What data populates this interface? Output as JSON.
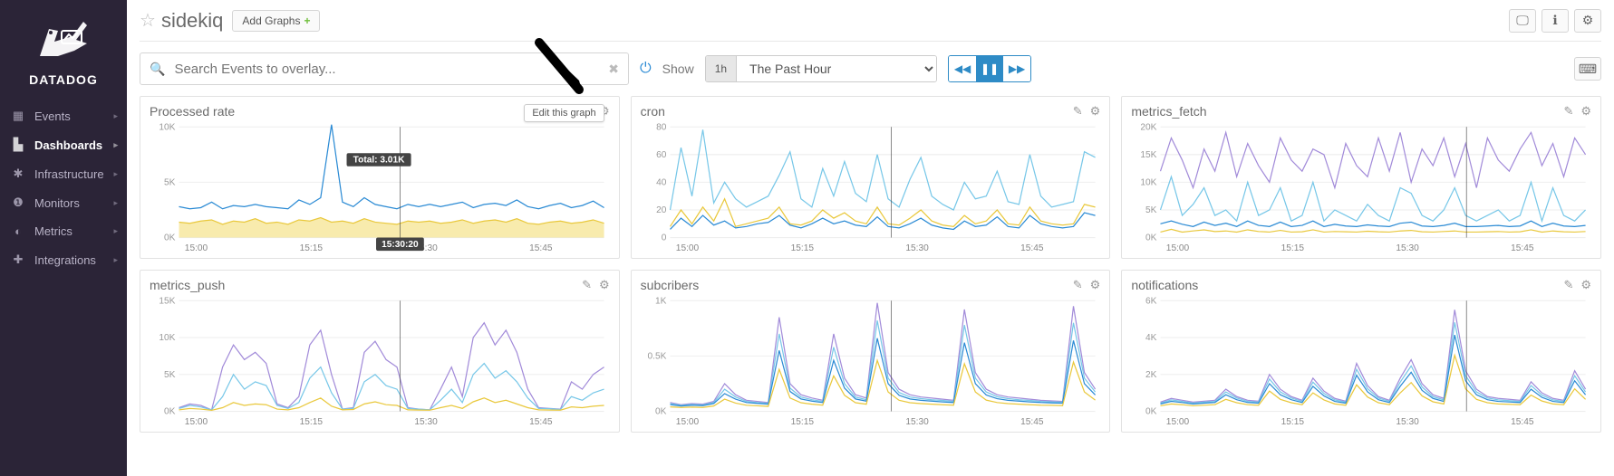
{
  "brand": "DATADOG",
  "nav": {
    "items": [
      {
        "icon": "calendar-icon",
        "label": "Events"
      },
      {
        "icon": "chart-icon",
        "label": "Dashboards",
        "active": true
      },
      {
        "icon": "nodes-icon",
        "label": "Infrastructure"
      },
      {
        "icon": "alert-icon",
        "label": "Monitors"
      },
      {
        "icon": "gauge-icon",
        "label": "Metrics"
      },
      {
        "icon": "plug-icon",
        "label": "Integrations"
      }
    ]
  },
  "header": {
    "title": "sidekiq",
    "add_graphs_label": "Add Graphs"
  },
  "toolbar": {
    "search_placeholder": "Search Events to overlay...",
    "show_label": "Show",
    "range_pill": "1h",
    "range_select": "The Past Hour"
  },
  "tooltip": {
    "edit_graph": "Edit this graph"
  },
  "cursor": {
    "time_label": "15:30:20",
    "total_label": "Total: 3.01K"
  },
  "x_ticks": [
    "15:00",
    "15:15",
    "15:30",
    "15:45"
  ],
  "colors": {
    "blue": "#2a8ad4",
    "cyan": "#77c7e8",
    "purple": "#a28bd9",
    "gold": "#e9c83c"
  },
  "chart_data": [
    {
      "id": "processed_rate",
      "title": "Processed rate",
      "type": "line",
      "x_ticks": [
        "15:00",
        "15:15",
        "15:30",
        "15:45"
      ],
      "ylim": [
        0,
        10000
      ],
      "y_ticks": [
        0,
        5000,
        10000
      ],
      "y_tick_labels": [
        "0K",
        "5K",
        "10K"
      ],
      "cursor_x": 0.52,
      "series": [
        {
          "name": "blue",
          "color": "#2a8ad4",
          "values": [
            2800,
            2600,
            2700,
            3200,
            2600,
            2900,
            2800,
            3000,
            2800,
            2700,
            2600,
            3400,
            3000,
            3600,
            10200,
            3200,
            2800,
            3600,
            3000,
            2800,
            2600,
            3000,
            2800,
            3011,
            2800,
            3000,
            3200,
            2700,
            3000,
            3100,
            2900,
            3400,
            2800,
            2600,
            2900,
            3100,
            2700,
            2900,
            3300,
            2700
          ]
        },
        {
          "name": "gold_area",
          "color": "#e9c83c",
          "area": true,
          "values": [
            1400,
            1300,
            1500,
            1600,
            1200,
            1500,
            1400,
            1700,
            1300,
            1400,
            1200,
            1600,
            1500,
            1800,
            1400,
            1500,
            1300,
            1700,
            1400,
            1300,
            1200,
            1500,
            1400,
            1500,
            1300,
            1400,
            1600,
            1300,
            1500,
            1600,
            1400,
            1700,
            1300,
            1200,
            1400,
            1500,
            1300,
            1400,
            1600,
            1300
          ]
        }
      ]
    },
    {
      "id": "cron",
      "title": "cron",
      "type": "line",
      "x_ticks": [
        "15:00",
        "15:15",
        "15:30",
        "15:45"
      ],
      "ylim": [
        0,
        80
      ],
      "y_ticks": [
        0,
        20,
        40,
        60,
        80
      ],
      "y_tick_labels": [
        "0",
        "20",
        "40",
        "60",
        "80"
      ],
      "cursor_x": 0.52,
      "series": [
        {
          "name": "cyan",
          "color": "#77c7e8",
          "values": [
            20,
            65,
            30,
            78,
            25,
            40,
            28,
            22,
            26,
            30,
            45,
            62,
            28,
            22,
            50,
            30,
            55,
            32,
            26,
            60,
            28,
            22,
            42,
            58,
            30,
            24,
            20,
            40,
            28,
            30,
            48,
            26,
            24,
            60,
            30,
            22,
            24,
            26,
            62,
            58
          ]
        },
        {
          "name": "gold",
          "color": "#e9c83c",
          "values": [
            8,
            20,
            10,
            22,
            12,
            28,
            8,
            10,
            12,
            14,
            22,
            10,
            9,
            12,
            20,
            14,
            18,
            12,
            10,
            22,
            10,
            9,
            14,
            20,
            12,
            9,
            8,
            16,
            10,
            12,
            20,
            10,
            9,
            22,
            12,
            10,
            9,
            10,
            24,
            22
          ]
        },
        {
          "name": "blue",
          "color": "#2a8ad4",
          "values": [
            6,
            14,
            8,
            16,
            9,
            12,
            7,
            8,
            10,
            11,
            16,
            9,
            7,
            10,
            14,
            10,
            12,
            9,
            8,
            15,
            8,
            7,
            10,
            14,
            9,
            7,
            6,
            12,
            8,
            9,
            15,
            8,
            7,
            16,
            10,
            8,
            7,
            8,
            18,
            16
          ]
        }
      ]
    },
    {
      "id": "metrics_fetch",
      "title": "metrics_fetch",
      "type": "line",
      "x_ticks": [
        "15:00",
        "15:15",
        "15:30",
        "15:45"
      ],
      "ylim": [
        0,
        20000
      ],
      "y_ticks": [
        0,
        5000,
        10000,
        15000,
        20000
      ],
      "y_tick_labels": [
        "0K",
        "5K",
        "10K",
        "15K",
        "20K"
      ],
      "cursor_x": 0.72,
      "series": [
        {
          "name": "purple",
          "color": "#a28bd9",
          "values": [
            12000,
            18000,
            14000,
            9000,
            16000,
            12000,
            19000,
            11000,
            17000,
            13000,
            10000,
            18000,
            14000,
            12000,
            16000,
            15000,
            9000,
            17000,
            13000,
            11000,
            18000,
            12000,
            19000,
            10000,
            16000,
            13000,
            18000,
            11000,
            17000,
            9000,
            18000,
            14000,
            12000,
            16000,
            19000,
            13000,
            17000,
            11000,
            18000,
            15000
          ]
        },
        {
          "name": "cyan",
          "color": "#77c7e8",
          "values": [
            5000,
            11000,
            4000,
            6000,
            9000,
            4000,
            5000,
            3000,
            10000,
            4000,
            5000,
            9000,
            3000,
            4000,
            10000,
            3000,
            5000,
            4000,
            3000,
            6000,
            4000,
            3000,
            9000,
            8000,
            4000,
            3000,
            5000,
            9000,
            4000,
            3000,
            4000,
            5000,
            3000,
            4000,
            10000,
            3000,
            9000,
            4000,
            3000,
            5000
          ]
        },
        {
          "name": "blue",
          "color": "#2a8ad4",
          "values": [
            2500,
            3000,
            2400,
            2000,
            2800,
            2200,
            2600,
            2000,
            3000,
            2200,
            2000,
            2800,
            2000,
            2200,
            3000,
            2000,
            2400,
            2100,
            2000,
            2300,
            2100,
            2000,
            2600,
            2800,
            2100,
            2000,
            2200,
            2600,
            2000,
            2000,
            2100,
            2200,
            2000,
            2100,
            3000,
            2000,
            2600,
            2100,
            2000,
            2200
          ]
        },
        {
          "name": "gold",
          "color": "#e9c83c",
          "values": [
            1000,
            1500,
            1000,
            1200,
            1400,
            1100,
            1200,
            1000,
            1400,
            1100,
            1000,
            1300,
            1000,
            1050,
            1400,
            1000,
            1100,
            1050,
            1000,
            1150,
            1050,
            1000,
            1200,
            1300,
            1050,
            1000,
            1100,
            1200,
            1000,
            1000,
            1050,
            1100,
            1000,
            1050,
            1400,
            1000,
            1200,
            1050,
            1000,
            1100
          ]
        }
      ]
    },
    {
      "id": "metrics_push",
      "title": "metrics_push",
      "type": "line",
      "x_ticks": [
        "15:00",
        "15:15",
        "15:30",
        "15:45"
      ],
      "ylim": [
        0,
        15000
      ],
      "y_ticks": [
        0,
        5000,
        10000,
        15000
      ],
      "y_tick_labels": [
        "0K",
        "5K",
        "10K",
        "15K"
      ],
      "cursor_x": 0.52,
      "series": [
        {
          "name": "purple",
          "color": "#a28bd9",
          "values": [
            500,
            1000,
            800,
            200,
            6000,
            9000,
            7000,
            8000,
            6500,
            1000,
            500,
            2000,
            9000,
            11000,
            5000,
            300,
            500,
            8000,
            9500,
            7000,
            6000,
            500,
            300,
            200,
            3000,
            6000,
            2000,
            10000,
            12000,
            9000,
            11000,
            8000,
            3000,
            500,
            400,
            300,
            4000,
            3000,
            5000,
            6000
          ]
        },
        {
          "name": "cyan",
          "color": "#77c7e8",
          "values": [
            400,
            800,
            600,
            200,
            2000,
            5000,
            3000,
            4000,
            3500,
            800,
            400,
            1200,
            4500,
            6000,
            2500,
            300,
            400,
            4000,
            5000,
            3500,
            3000,
            400,
            300,
            200,
            1500,
            3000,
            1200,
            5000,
            6500,
            4500,
            5500,
            4000,
            1800,
            400,
            350,
            250,
            2000,
            1500,
            2500,
            3000
          ]
        },
        {
          "name": "gold",
          "color": "#e9c83c",
          "values": [
            200,
            400,
            300,
            150,
            500,
            1200,
            800,
            1000,
            900,
            300,
            200,
            500,
            1200,
            1800,
            700,
            200,
            250,
            1000,
            1300,
            900,
            800,
            200,
            180,
            150,
            500,
            800,
            400,
            1300,
            1800,
            1200,
            1500,
            1000,
            500,
            200,
            180,
            160,
            600,
            500,
            700,
            800
          ]
        }
      ]
    },
    {
      "id": "subcribers",
      "title": "subcribers",
      "type": "line",
      "x_ticks": [
        "15:00",
        "15:15",
        "15:30",
        "15:45"
      ],
      "ylim": [
        0,
        1000
      ],
      "y_ticks": [
        0,
        500,
        1000
      ],
      "y_tick_labels": [
        "0K",
        "0.5K",
        "1K"
      ],
      "cursor_x": 0.52,
      "series": [
        {
          "name": "purple",
          "color": "#a28bd9",
          "values": [
            80,
            60,
            70,
            65,
            90,
            250,
            150,
            100,
            90,
            80,
            850,
            250,
            150,
            120,
            100,
            700,
            300,
            150,
            120,
            980,
            350,
            200,
            150,
            130,
            120,
            110,
            100,
            920,
            350,
            200,
            150,
            130,
            120,
            110,
            100,
            95,
            90,
            950,
            350,
            200
          ]
        },
        {
          "name": "cyan",
          "color": "#77c7e8",
          "values": [
            70,
            55,
            62,
            58,
            80,
            200,
            130,
            90,
            80,
            72,
            700,
            210,
            130,
            105,
            90,
            580,
            250,
            130,
            105,
            820,
            300,
            170,
            130,
            115,
            105,
            98,
            90,
            780,
            300,
            175,
            132,
            115,
            105,
            98,
            90,
            86,
            82,
            800,
            300,
            175
          ]
        },
        {
          "name": "blue",
          "color": "#2a8ad4",
          "values": [
            60,
            48,
            55,
            52,
            70,
            160,
            110,
            80,
            72,
            65,
            550,
            180,
            112,
            92,
            80,
            460,
            210,
            112,
            92,
            660,
            250,
            145,
            112,
            100,
            92,
            86,
            80,
            620,
            250,
            148,
            114,
            100,
            92,
            86,
            80,
            76,
            74,
            640,
            250,
            148
          ]
        },
        {
          "name": "gold",
          "color": "#e9c83c",
          "values": [
            40,
            35,
            38,
            36,
            48,
            110,
            75,
            55,
            50,
            45,
            380,
            120,
            78,
            64,
            56,
            320,
            145,
            78,
            64,
            460,
            175,
            100,
            78,
            70,
            64,
            60,
            56,
            430,
            175,
            102,
            80,
            70,
            64,
            60,
            56,
            54,
            52,
            445,
            175,
            102
          ]
        }
      ]
    },
    {
      "id": "notifications",
      "title": "notifications",
      "type": "line",
      "x_ticks": [
        "15:00",
        "15:15",
        "15:30",
        "15:45"
      ],
      "ylim": [
        0,
        6000
      ],
      "y_ticks": [
        0,
        2000,
        4000,
        6000
      ],
      "y_tick_labels": [
        "0K",
        "2K",
        "4K",
        "6K"
      ],
      "cursor_x": 0.72,
      "series": [
        {
          "name": "purple",
          "color": "#a28bd9",
          "values": [
            500,
            700,
            600,
            500,
            550,
            600,
            1200,
            800,
            600,
            550,
            2000,
            1200,
            800,
            600,
            1800,
            1100,
            700,
            550,
            2600,
            1400,
            800,
            600,
            1800,
            2800,
            1500,
            900,
            700,
            5500,
            2200,
            1200,
            800,
            700,
            650,
            600,
            1600,
            1000,
            700,
            600,
            2200,
            1200
          ]
        },
        {
          "name": "cyan",
          "color": "#77c7e8",
          "values": [
            450,
            620,
            540,
            450,
            500,
            540,
            1050,
            720,
            540,
            500,
            1750,
            1050,
            720,
            540,
            1580,
            970,
            620,
            500,
            2280,
            1230,
            720,
            540,
            1580,
            2460,
            1320,
            800,
            620,
            4820,
            1930,
            1050,
            720,
            620,
            580,
            540,
            1400,
            880,
            620,
            540,
            1930,
            1050
          ]
        },
        {
          "name": "blue",
          "color": "#2a8ad4",
          "values": [
            400,
            540,
            480,
            400,
            440,
            480,
            900,
            630,
            480,
            440,
            1500,
            900,
            630,
            480,
            1360,
            840,
            540,
            440,
            1960,
            1060,
            630,
            480,
            1360,
            2120,
            1140,
            700,
            540,
            4140,
            1660,
            900,
            630,
            540,
            510,
            480,
            1200,
            760,
            540,
            480,
            1660,
            900
          ]
        },
        {
          "name": "gold",
          "color": "#e9c83c",
          "values": [
            300,
            400,
            360,
            300,
            330,
            360,
            650,
            470,
            360,
            330,
            1100,
            650,
            470,
            360,
            1000,
            620,
            400,
            330,
            1440,
            780,
            470,
            360,
            1000,
            1560,
            840,
            520,
            400,
            3040,
            1220,
            650,
            470,
            400,
            380,
            360,
            880,
            560,
            400,
            360,
            1220,
            650
          ]
        }
      ]
    }
  ]
}
